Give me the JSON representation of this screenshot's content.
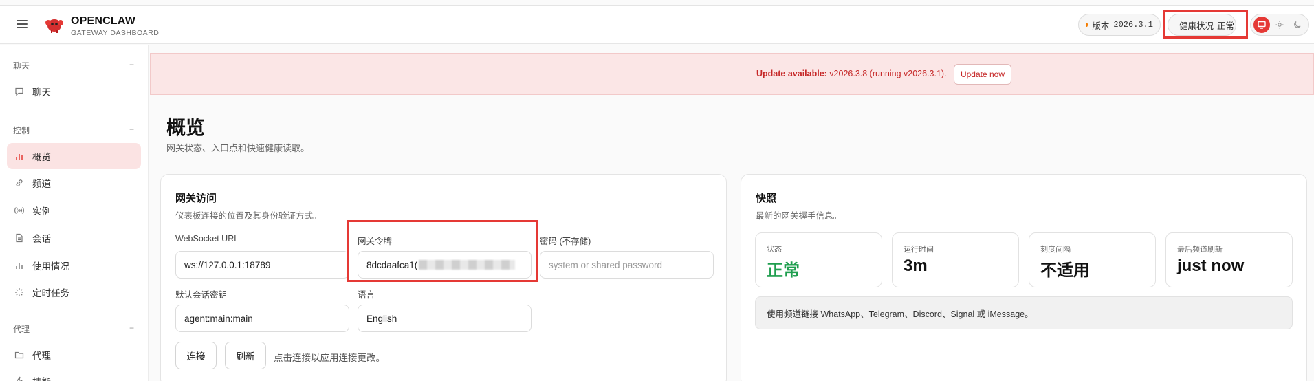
{
  "brand": {
    "title": "OPENCLAW",
    "subtitle": "GATEWAY DASHBOARD"
  },
  "header": {
    "version_label": "版本",
    "version_value": "2026.3.1",
    "version_dot_color": "#f57c00",
    "health_label": "健康状况",
    "health_value": "正常",
    "health_dot_color": "#2e9e4f",
    "theme_options": [
      "system-monitor-icon",
      "sun-icon",
      "moon-icon"
    ],
    "active_theme": "system-monitor-icon"
  },
  "sidebar": {
    "sections": [
      {
        "title": "聊天",
        "items": [
          {
            "label": "聊天",
            "icon": "chat-bubble-icon"
          }
        ]
      },
      {
        "title": "控制",
        "items": [
          {
            "label": "概览",
            "icon": "bar-chart-icon",
            "active": true
          },
          {
            "label": "频道",
            "icon": "link-icon"
          },
          {
            "label": "实例",
            "icon": "broadcast-icon"
          },
          {
            "label": "会话",
            "icon": "document-icon"
          },
          {
            "label": "使用情况",
            "icon": "usage-chart-icon"
          },
          {
            "label": "定时任务",
            "icon": "loader-icon"
          }
        ]
      },
      {
        "title": "代理",
        "items": [
          {
            "label": "代理",
            "icon": "folder-icon"
          },
          {
            "label": "技能",
            "icon": "bolt-icon"
          }
        ]
      }
    ],
    "collapse_symbol": "−"
  },
  "banner": {
    "bold": "Update available:",
    "text": " v2026.3.8 (running v2026.3.1).",
    "button": "Update now"
  },
  "page": {
    "title": "概览",
    "subtitle": "网关状态、入口点和快速健康读取。"
  },
  "gateway_access": {
    "title": "网关访问",
    "subtitle": "仪表板连接的位置及其身份验证方式。",
    "websocket_label": "WebSocket URL",
    "websocket_value": "ws://127.0.0.1:18789",
    "token_label": "网关令牌",
    "token_value_visible": "8dcdaafca1(",
    "password_label": "密码 (不存储)",
    "password_placeholder": "system or shared password",
    "session_key_label": "默认会话密钥",
    "session_key_value": "agent:main:main",
    "language_label": "语言",
    "language_value": "English",
    "connect_button": "连接",
    "refresh_button": "刷新",
    "hint": "点击连接以应用连接更改。"
  },
  "snapshot": {
    "title": "快照",
    "subtitle": "最新的网关握手信息。",
    "stats": [
      {
        "label": "状态",
        "value": "正常",
        "status": "ok"
      },
      {
        "label": "运行时间",
        "value": "3m"
      },
      {
        "label": "刻度间隔",
        "value": "不适用"
      },
      {
        "label": "最后频道刷新",
        "value": "just now"
      }
    ],
    "info": "使用频道链接 WhatsApp、Telegram、Discord、Signal 或 iMessage。"
  },
  "colors": {
    "accent": "#e53935",
    "ok": "#1e9e4e",
    "banner_bg": "#fbe6e6"
  }
}
